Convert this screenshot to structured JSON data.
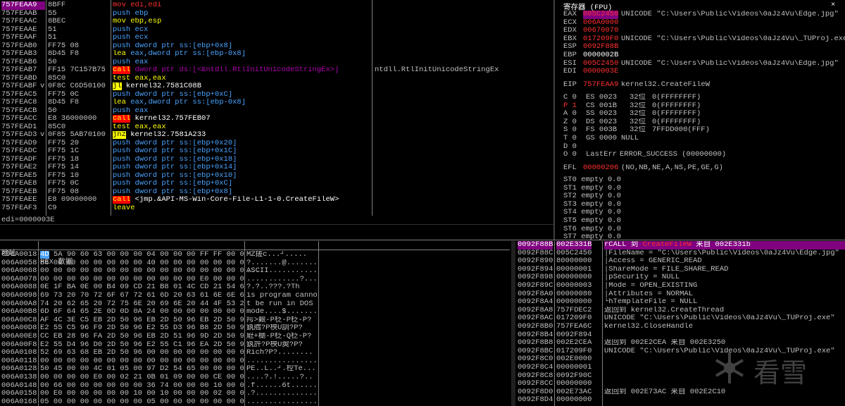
{
  "disasm": {
    "rows": [
      {
        "addr": "757FEAA9",
        "bytes": "8BFF",
        "instr": "mov edi,edi",
        "comment": "",
        "sel": true
      },
      {
        "addr": "757FEAAB",
        "bytes": "55",
        "instr": "push ebp",
        "comment": ""
      },
      {
        "addr": "757FEAAC",
        "bytes": "8BEC",
        "instr": "mov ebp,esp",
        "comment": ""
      },
      {
        "addr": "757FEAAE",
        "bytes": "51",
        "instr": "push ecx",
        "comment": ""
      },
      {
        "addr": "757FEAAF",
        "bytes": "51",
        "instr": "push ecx",
        "comment": ""
      },
      {
        "addr": "757FEAB0",
        "bytes": "FF75 08",
        "instr": "push dword ptr ss:[ebp+0x8]",
        "comment": ""
      },
      {
        "addr": "757FEAB3",
        "bytes": "8D45 F8",
        "instr": "lea eax,dword ptr ss:[ebp-0x8]",
        "comment": ""
      },
      {
        "addr": "757FEAB6",
        "bytes": "50",
        "instr": "push eax",
        "comment": ""
      },
      {
        "addr": "757FEAB7",
        "bytes": "FF15 7C157B75",
        "instr": "call dword ptr ds:[<&ntdll.RtlInitUnicodeStringEx>]",
        "comment": "ntdll.RtlInitUnicodeStringEx"
      },
      {
        "addr": "757FEABD",
        "bytes": "85C0",
        "instr": "test eax,eax",
        "comment": ""
      },
      {
        "addr": "757FEABF",
        "bytes": "0F8C C6D50100",
        "instr": "jl kernel32.7581C08B",
        "comment": "",
        "mark": "v"
      },
      {
        "addr": "757FEAC5",
        "bytes": "FF75 0C",
        "instr": "push dword ptr ss:[ebp+0xC]",
        "comment": ""
      },
      {
        "addr": "757FEAC8",
        "bytes": "8D45 F8",
        "instr": "lea eax,dword ptr ss:[ebp-0x8]",
        "comment": ""
      },
      {
        "addr": "757FEACB",
        "bytes": "50",
        "instr": "push eax",
        "comment": ""
      },
      {
        "addr": "757FEACC",
        "bytes": "E8 36000000",
        "instr": "call kernel32.757FEB07",
        "comment": ""
      },
      {
        "addr": "757FEAD1",
        "bytes": "85C0",
        "instr": "test eax,eax",
        "comment": ""
      },
      {
        "addr": "757FEAD3",
        "bytes": "0F85 5AB70100",
        "instr": "jnz kernel32.7581A233",
        "comment": "",
        "mark": "v"
      },
      {
        "addr": "757FEAD9",
        "bytes": "FF75 20",
        "instr": "push dword ptr ss:[ebp+0x20]",
        "comment": ""
      },
      {
        "addr": "757FEADC",
        "bytes": "FF75 1C",
        "instr": "push dword ptr ss:[ebp+0x1C]",
        "comment": ""
      },
      {
        "addr": "757FEADF",
        "bytes": "FF75 18",
        "instr": "push dword ptr ss:[ebp+0x18]",
        "comment": ""
      },
      {
        "addr": "757FEAE2",
        "bytes": "FF75 14",
        "instr": "push dword ptr ss:[ebp+0x14]",
        "comment": ""
      },
      {
        "addr": "757FEAE5",
        "bytes": "FF75 10",
        "instr": "push dword ptr ss:[ebp+0x10]",
        "comment": ""
      },
      {
        "addr": "757FEAE8",
        "bytes": "FF75 0C",
        "instr": "push dword ptr ss:[ebp+0xC]",
        "comment": ""
      },
      {
        "addr": "757FEAEB",
        "bytes": "FF75 08",
        "instr": "push dword ptr ss:[ebp+0x8]",
        "comment": ""
      },
      {
        "addr": "757FEAEE",
        "bytes": "E8 09000000",
        "instr": "call <jmp.&API-MS-Win-Core-File-L1-1-0.CreateFileW>",
        "comment": ""
      },
      {
        "addr": "757FEAF3",
        "bytes": "C9",
        "instr": "leave",
        "comment": ""
      }
    ],
    "status": "edi=0000003E"
  },
  "registers": {
    "header": "寄存器 (FPU)",
    "gp": [
      {
        "name": "EAX",
        "value": "005C2450",
        "comment": "UNICODE \"C:\\Users\\Public\\Videos\\0aJz4Vu\\Edge.jpg\"",
        "hl": true
      },
      {
        "name": "ECX",
        "value": "006A0000",
        "comment": ""
      },
      {
        "name": "EDX",
        "value": "00670070",
        "comment": ""
      },
      {
        "name": "EBX",
        "value": "017209F0",
        "comment": "UNICODE \"C:\\Users\\Public\\Videos\\0aJz4Vu\\_TUProj.exe\""
      },
      {
        "name": "ESP",
        "value": "0092F88B",
        "comment": ""
      },
      {
        "name": "EBP",
        "value": "0000002B",
        "comment": "",
        "white": true
      },
      {
        "name": "ESI",
        "value": "005C2450",
        "comment": "UNICODE \"C:\\Users\\Public\\Videos\\0aJz4Vu\\Edge.jpg\""
      },
      {
        "name": "EDI",
        "value": "0000003E",
        "comment": ""
      }
    ],
    "eip": {
      "name": "EIP",
      "value": "757FEAA9",
      "comment": "kernel32.CreateFileW"
    },
    "flags": [
      {
        "f": "C 0",
        "seg": "ES 0023",
        "bits": "32位",
        "info": "0(FFFFFFFF)"
      },
      {
        "f": "P 1",
        "seg": "CS 001B",
        "bits": "32位",
        "info": "0(FFFFFFFF)",
        "red": true
      },
      {
        "f": "A 0",
        "seg": "SS 0023",
        "bits": "32位",
        "info": "0(FFFFFFFF)"
      },
      {
        "f": "Z 0",
        "seg": "DS 0023",
        "bits": "32位",
        "info": "0(FFFFFFFF)"
      },
      {
        "f": "S 0",
        "seg": "FS 003B",
        "bits": "32位",
        "info": "7FFDD000(FFF)"
      },
      {
        "f": "T 0",
        "seg": "GS 0000",
        "bits": "",
        "info": "NULL"
      },
      {
        "f": "D 0",
        "seg": "",
        "bits": "",
        "info": ""
      },
      {
        "f": "O 0",
        "seg": "LastErr",
        "bits": "",
        "info": "ERROR_SUCCESS (00000000)"
      }
    ],
    "efl": {
      "name": "EFL",
      "value": "00000206",
      "comment": "(NO,NB,NE,A,NS,PE,GE,G)"
    },
    "fpu": [
      "ST0 empty 0.0",
      "ST1 empty 0.0",
      "ST2 empty 0.0",
      "ST3 empty 0.0",
      "ST4 empty 0.0",
      "ST5 empty 0.0",
      "ST6 empty 0.0",
      "ST7 empty 0.0"
    ]
  },
  "dump": {
    "col_addr": "地址",
    "col_hex": "HEX 数据",
    "col_ascii": "ASCII",
    "rows": [
      {
        "addr": "006A0018",
        "hex": "4D 5A 90 60 63 00 00 00 04 00 00 00 FF FF 00 00",
        "ascii": "MZ搓c...┘.....",
        "first": true
      },
      {
        "addr": "006A0058",
        "hex": "B8 00 00 00 00 00 00 00 40 00 00 00 00 00 00 00",
        "ascii": "?.......@......."
      },
      {
        "addr": "006A0068",
        "hex": "00 00 00 00 00 00 00 00 00 00 00 00 00 00 00 00",
        "ascii": "................"
      },
      {
        "addr": "006A0078",
        "hex": "00 00 00 00 00 00 00 00 00 00 00 00 E0 00 00 00",
        "ascii": "............?..."
      },
      {
        "addr": "006A0088",
        "hex": "0E 1F BA 0E 00 B4 09 CD 21 B8 01 4C CD 21 54 68",
        "ascii": "?.?..???.?Th"
      },
      {
        "addr": "006A0098",
        "hex": "69 73 20 70 72 6F 67 72 61 6D 20 63 61 6E 6E 6F",
        "ascii": "is program canno"
      },
      {
        "addr": "006A00A8",
        "hex": "74 20 62 65 20 72 75 6E 20 69 6E 20 44 4F 53 20",
        "ascii": "t be run in DOS "
      },
      {
        "addr": "006A00B8",
        "hex": "6D 6F 64 65 2E 0D 0D 0A 24 00 00 00 00 00 00 00",
        "ascii": "mode....$......."
      },
      {
        "addr": "006A00C8",
        "hex": "AF 4C 3E C5 EB 2D 50 96 EB 2D 50 96 EB 2D 50 96",
        "ascii": "疞>艱-P柉-P柉-P?"
      },
      {
        "addr": "006A00D8",
        "hex": "E2 55 C5 96 F9 2D 50 96 E2 55 D3 96 B8 2D 50 96",
        "ascii": "釻艝?P柍U訓?P?"
      },
      {
        "addr": "006A00E8",
        "hex": "CC EB 28 96 FA 2D 50 96 EB 2D 51 96 9D 2D 50 96",
        "ascii": "屘+樃-P柉-Q柉-P?"
      },
      {
        "addr": "006A00F8",
        "hex": "E2 55 D4 96 D0 2D 50 96 E2 55 C1 96 EA 2D 50 96",
        "ascii": "釻許?P柍U翜?P?"
      },
      {
        "addr": "006A0108",
        "hex": "52 69 63 68 EB 2D 50 96 00 00 00 00 00 00 00 00",
        "ascii": "Rich?P?........"
      },
      {
        "addr": "006A0118",
        "hex": "00 00 00 00 00 00 00 00 00 00 00 00 00 00 00 00",
        "ascii": "................"
      },
      {
        "addr": "006A0128",
        "hex": "50 45 00 00 4C 01 05 00 97 D2 54 65 00 00 00 00",
        "ascii": "PE..L..┘.椌Te...."
      },
      {
        "addr": "006A0138",
        "hex": "00 00 00 00 E0 00 02 21 0B 01 09 00 00 CE 00 00",
        "ascii": "....?.!.....?.."
      },
      {
        "addr": "006A0148",
        "hex": "00 66 00 00 00 00 00 00 36 74 00 00 00 10 00 00",
        "ascii": ".f......6t......"
      },
      {
        "addr": "006A0158",
        "hex": "00 E0 00 00 00 00 00 10 00 10 00 00 00 02 00 00",
        "ascii": ".?.............."
      },
      {
        "addr": "006A0168",
        "hex": "05 00 00 00 00 00 00 00 05 00 00 00 00 00 00 00",
        "ascii": "................"
      }
    ]
  },
  "stack": {
    "rows": [
      {
        "addr": "0092F88B",
        "value": "002E331B",
        "comment": "rCALL 到 CreateFileW 来自 002E331b",
        "first": true,
        "cfw": "CreateFileW"
      },
      {
        "addr": "0092F88C",
        "value": "005C2450",
        "comment": "│FileName = \"C:\\Users\\Public\\Videos\\0aJz4Vu\\Edge.jpg\""
      },
      {
        "addr": "0092F890",
        "value": "80000000",
        "comment": "│Access = GENERIC_READ"
      },
      {
        "addr": "0092F894",
        "value": "00000001",
        "comment": "│ShareMode = FILE_SHARE_READ"
      },
      {
        "addr": "0092F898",
        "value": "00000000",
        "comment": "│pSecurity = NULL"
      },
      {
        "addr": "0092F89C",
        "value": "00000003",
        "comment": "│Mode = OPEN_EXISTING"
      },
      {
        "addr": "0092F8A0",
        "value": "00000080",
        "comment": "│Attributes = NORMAL"
      },
      {
        "addr": "0092F8A4",
        "value": "00000000",
        "comment": "└hTemplateFile = NULL"
      },
      {
        "addr": "0092F8A8",
        "value": "757FDEC2",
        "comment": "返回到 kernel32.CreateThread"
      },
      {
        "addr": "0092F8AC",
        "value": "017209F0",
        "comment": "UNICODE \"C:\\Users\\Public\\Videos\\0aJz4Vu\\_TUProj.exe\""
      },
      {
        "addr": "0092F8B0",
        "value": "757FEA6C",
        "comment": "kernel32.CloseHandle"
      },
      {
        "addr": "0092F8B4",
        "value": "0092F894",
        "comment": ""
      },
      {
        "addr": "0092F8B8",
        "value": "002E2CEA",
        "comment": "返回到 002E2CEA 来自 002E3250"
      },
      {
        "addr": "0092F8BC",
        "value": "017209F0",
        "comment": "UNICODE \"C:\\Users\\Public\\Videos\\0aJz4Vu\\_TUProj.exe\""
      },
      {
        "addr": "0092F8C0",
        "value": "002E0000",
        "comment": ""
      },
      {
        "addr": "0092F8C4",
        "value": "00000001",
        "comment": ""
      },
      {
        "addr": "0092F8C8",
        "value": "0092F90C",
        "comment": ""
      },
      {
        "addr": "0092F8CC",
        "value": "00000000",
        "comment": ""
      },
      {
        "addr": "0092F8D0",
        "value": "002E73AC",
        "comment": "返回到 002E73AC 来自 002E2C10"
      },
      {
        "addr": "0092F8D4",
        "value": "00000000",
        "comment": ""
      }
    ]
  },
  "watermark": {
    "text": "看雪",
    "icon": "snowflake-icon"
  },
  "colors": {
    "selection": "#800080",
    "highlight": "#ff0000",
    "jump": "#ffff00",
    "push": "#4aa3ff"
  }
}
